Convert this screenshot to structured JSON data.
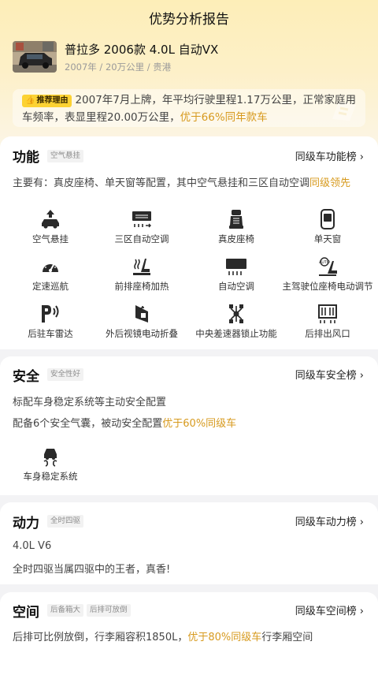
{
  "header": {
    "title": "优势分析报告"
  },
  "car": {
    "name": "普拉多 2006款 4.0L 自动VX",
    "meta": "2007年 / 20万公里 / 贵港"
  },
  "reason": {
    "tag": "推荐理由",
    "text": "2007年7月上牌，年平均行驶里程1.17万公里，正常家庭用车频率，表显里程20.00万公里，",
    "highlight": "优于66%同年款车"
  },
  "function": {
    "title": "功能",
    "chip": "空气悬挂",
    "rank_link": "同级车功能榜",
    "summary": "主要有：真皮座椅、单天窗等配置，其中空气悬挂和三区自动空调",
    "summary_highlight": "同级领先",
    "items": [
      {
        "label": "空气悬挂",
        "icon": "air-suspension-icon"
      },
      {
        "label": "三区自动空调",
        "icon": "tri-zone-ac-icon"
      },
      {
        "label": "真皮座椅",
        "icon": "leather-seat-icon"
      },
      {
        "label": "单天窗",
        "icon": "sunroof-icon"
      },
      {
        "label": "定速巡航",
        "icon": "cruise-control-icon"
      },
      {
        "label": "前排座椅加热",
        "icon": "seat-heating-icon"
      },
      {
        "label": "自动空调",
        "icon": "auto-ac-icon"
      },
      {
        "label": "主驾驶位座椅电动调节",
        "icon": "power-seat-icon"
      },
      {
        "label": "后驻车雷达",
        "icon": "parking-radar-icon"
      },
      {
        "label": "外后视镜电动折叠",
        "icon": "mirror-fold-icon"
      },
      {
        "label": "中央差速器锁止功能",
        "icon": "diff-lock-icon"
      },
      {
        "label": "后排出风口",
        "icon": "rear-vent-icon"
      }
    ]
  },
  "safety": {
    "title": "安全",
    "chip": "安全性好",
    "rank_link": "同级车安全榜",
    "line1": "标配车身稳定系统等主动安全配置",
    "line2": "配备6个安全气囊，被动安全配置",
    "line2_highlight": "优于60%同级车",
    "items": [
      {
        "label": "车身稳定系统",
        "icon": "stability-control-icon"
      }
    ]
  },
  "power": {
    "title": "动力",
    "chip": "全时四驱",
    "rank_link": "同级车动力榜",
    "engine": "4.0L V6",
    "comment": "全时四驱当属四驱中的王者，真香!"
  },
  "space": {
    "title": "空间",
    "chip1": "后备箱大",
    "chip2": "后排可放倒",
    "rank_link": "同级车空间榜",
    "line_pre": "后排可比例放倒，行李厢容积1850L，",
    "line_highlight": "优于80%同级车",
    "line_post": "行李厢空间"
  },
  "colors": {
    "accent": "#d79a1e",
    "tag_bg": "#fcd233",
    "hero_top": "#fdeeb8"
  }
}
